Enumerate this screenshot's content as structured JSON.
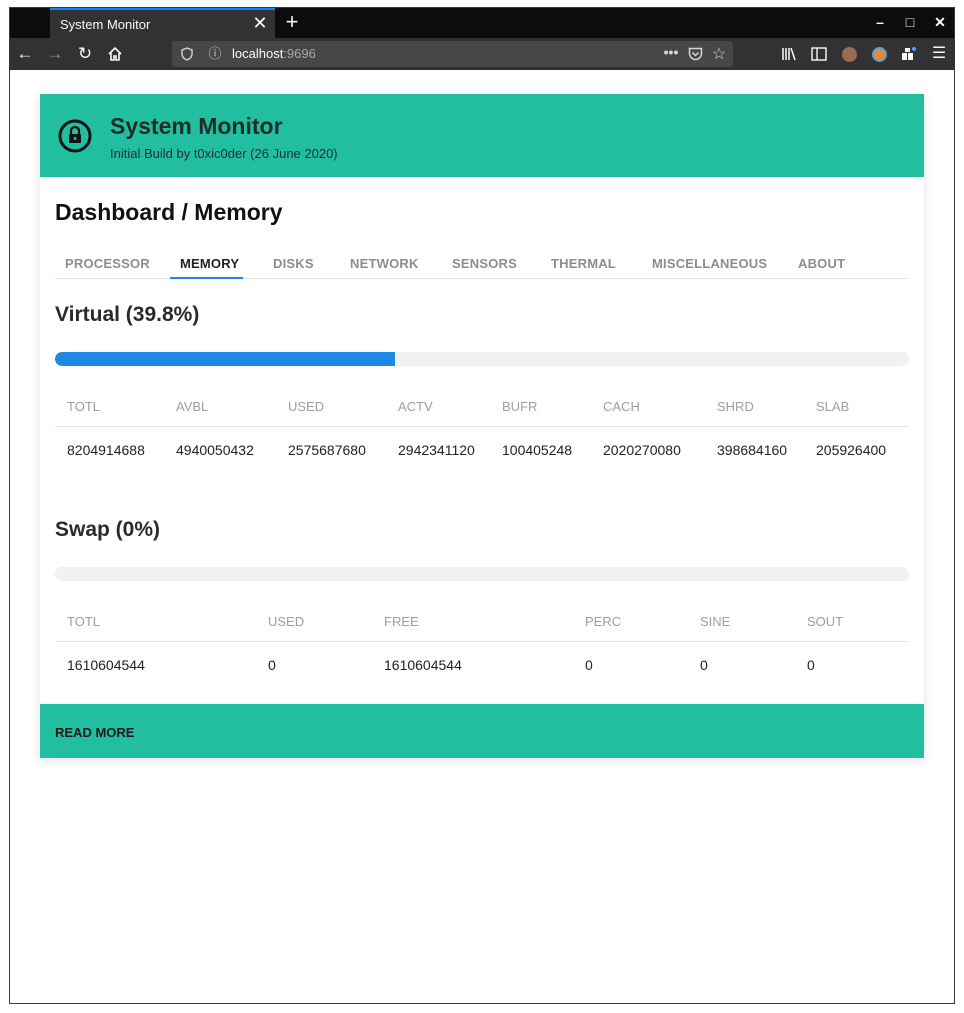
{
  "browser": {
    "tab_title": "System Monitor",
    "tab_close": "✕",
    "new_tab": "+",
    "url_host": "localhost",
    "url_port": ":9696",
    "window_controls": [
      "–",
      "□",
      "✕"
    ]
  },
  "header": {
    "title": "System Monitor",
    "subtitle": "Initial Build by t0xic0der (26 June 2020)"
  },
  "page_title": "Dashboard / Memory",
  "nav_tabs": [
    "PROCESSOR",
    "MEMORY",
    "DISKS",
    "NETWORK",
    "SENSORS",
    "THERMAL",
    "MISCELLANEOUS",
    "ABOUT"
  ],
  "active_tab": "MEMORY",
  "virtual": {
    "title": "Virtual (39.8%)",
    "percent": 39.8,
    "headers": [
      "TOTL",
      "AVBL",
      "USED",
      "ACTV",
      "BUFR",
      "CACH",
      "SHRD",
      "SLAB"
    ],
    "values": [
      "8204914688",
      "4940050432",
      "2575687680",
      "2942341120",
      "100405248",
      "2020270080",
      "398684160",
      "205926400"
    ]
  },
  "swap": {
    "title": "Swap (0%)",
    "percent": 0,
    "headers": [
      "TOTL",
      "USED",
      "FREE",
      "PERC",
      "SINE",
      "SOUT"
    ],
    "values": [
      "1610604544",
      "0",
      "1610604544",
      "0",
      "0",
      "0"
    ]
  },
  "footer": {
    "read_more": "READ MORE"
  },
  "colors": {
    "accent": "#21bf9f",
    "progress": "#1e88e5"
  }
}
